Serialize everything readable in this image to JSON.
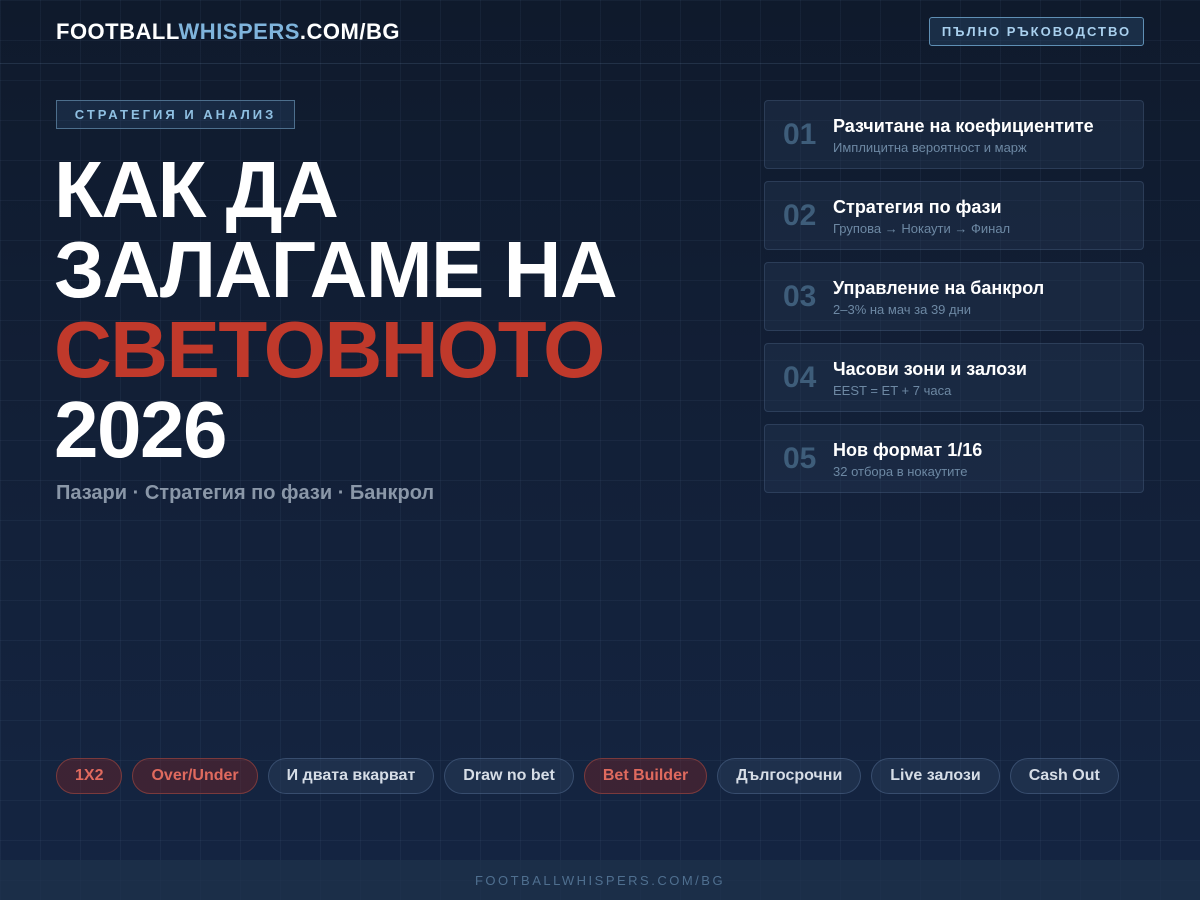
{
  "header": {
    "logo_main": "FOOTBALL",
    "logo_accent": "WHISPERS",
    "logo_suffix": ".COM/BG",
    "guide_button": "ПЪЛНО РЪКОВОДСТВО"
  },
  "hero": {
    "tag": "СТРАТЕГИЯ И АНАЛИЗ",
    "headline_line1": "КАК ДА",
    "headline_line2": "ЗАЛАГАМЕ НА",
    "headline_line3": "СВЕТОВНОТО",
    "headline_line4": "2026",
    "subtitle": "Пазари · Стратегия по фази · Банкрол"
  },
  "steps": [
    {
      "num": "01",
      "title": "Разчитане на коефициентите",
      "desc": "Имплицитна вероятност и марж"
    },
    {
      "num": "02",
      "title": "Стратегия по фази",
      "desc": "Групова → Нокаути → Финал"
    },
    {
      "num": "03",
      "title": "Управление на банкрол",
      "desc": "2–3% на мач за 39 дни"
    },
    {
      "num": "04",
      "title": "Часови зони и залози",
      "desc": "EEST = ET + 7 часа"
    },
    {
      "num": "05",
      "title": "Нов формат 1/16",
      "desc": "32 отбора в нокаутите"
    }
  ],
  "markets": [
    {
      "label": "1X2"
    },
    {
      "label": "Over/Under"
    },
    {
      "label": "И двата вкарват"
    },
    {
      "label": "Draw no bet"
    },
    {
      "label": "Bet Builder"
    },
    {
      "label": "Дългосрочни"
    },
    {
      "label": "Live залози"
    },
    {
      "label": "Cash Out"
    }
  ],
  "footer": {
    "text": "FOOTBALLWHISPERS.COM/BG"
  },
  "colors": {
    "accent_red": "#c0392b",
    "accent_blue": "#7fb4dc",
    "background": "#13213a"
  }
}
